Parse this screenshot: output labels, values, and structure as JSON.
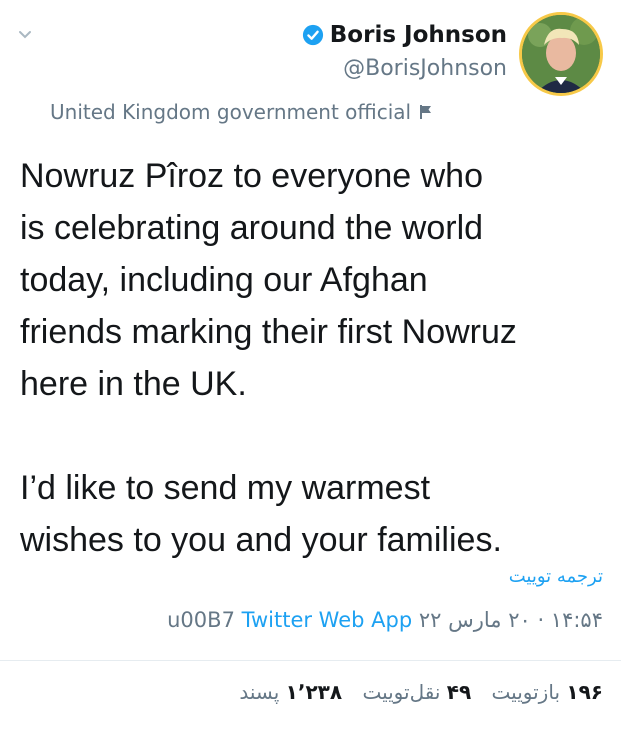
{
  "header": {
    "display_name": "Boris Johnson",
    "handle": "@BorisJohnson",
    "account_label": "United Kingdom government official"
  },
  "tweet": {
    "text": "Nowruz Pîroz to everyone who\nis celebrating around the world\ntoday, including our Afghan\nfriends marking their first Nowruz\nhere in the UK.\n\nI’d like to send my warmest\nwishes to you and your families.",
    "translate_label": "ترجمه توییت",
    "timestamp": "۱۴:۵۴ · ۲۰ مارس ۲۲",
    "separator": "u00B7",
    "source": "Twitter Web App"
  },
  "stats": {
    "retweets_count": "۱۹۶",
    "retweets_label": "بازتوییت",
    "quotes_count": "۴۹",
    "quotes_label": "نقل‌توییت",
    "likes_count": "۱٬۲۳۸",
    "likes_label": "پسند"
  },
  "icons": {
    "chevron": "chevron-down-icon",
    "verified": "verified-badge-icon",
    "flag": "flag-icon"
  },
  "colors": {
    "link": "#1da1f2",
    "secondary_text": "#657786",
    "primary_text": "#14171a",
    "avatar_ring": "#f7c948"
  }
}
